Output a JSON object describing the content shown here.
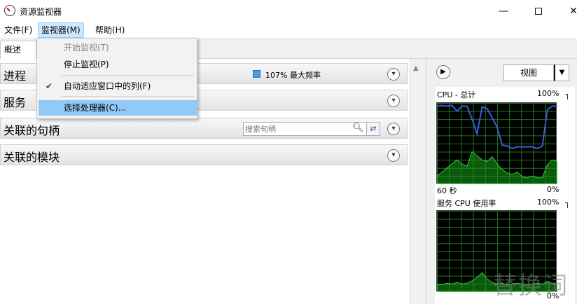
{
  "window": {
    "title": "资源监视器",
    "min": "—",
    "close": "✕"
  },
  "menubar": {
    "items": [
      "文件(F)",
      "监视器(M)",
      "帮助(H)"
    ]
  },
  "tabs": {
    "overview": "概述"
  },
  "left": {
    "sections": [
      {
        "title": "进程"
      },
      {
        "title": "服务"
      },
      {
        "title": "关联的句柄"
      },
      {
        "title": "关联的模块"
      }
    ],
    "process_legend": "107% 最大频率",
    "handles_search_placeholder": "搜索句柄",
    "chevron": "▾"
  },
  "right": {
    "view_button": "视图",
    "cpu_total_label": "CPU - 总计",
    "cpu_total_max": "100%",
    "cpu_time_label": "60 秒",
    "cpu_total_min": "0%",
    "service_cpu_label": "服务 CPU 使用率",
    "service_cpu_max": "100%",
    "service_cpu_min": "0%"
  },
  "dropdown": {
    "items": [
      "开始监视(T)",
      "停止监视(P)",
      "自动适应窗口中的列(F)",
      "选择处理器(C)..."
    ],
    "checked_index": 2,
    "disabled_index": 0,
    "highlight_index": 3
  },
  "watermark": "替换词",
  "colors": {
    "cpu_line": "#3f5bd6",
    "cpu_fill": "#17a117",
    "accent": "#91c9f7"
  },
  "chart_data": [
    {
      "type": "area",
      "title": "CPU - 总计",
      "ylim": [
        0,
        100
      ],
      "series": [
        {
          "values": [
            96,
            97,
            96,
            97,
            90,
            96,
            96,
            80,
            62,
            95,
            93,
            82,
            70,
            48,
            47,
            44,
            46,
            46,
            46,
            46,
            44,
            47,
            92,
            96,
            96
          ]
        },
        {
          "values": [
            10,
            15,
            20,
            25,
            30,
            25,
            22,
            40,
            35,
            30,
            28,
            34,
            25,
            18,
            14,
            12,
            15,
            9,
            8,
            10,
            8,
            8,
            24,
            30,
            28
          ]
        }
      ]
    },
    {
      "type": "area",
      "title": "服务 CPU 使用率",
      "ylim": [
        0,
        100
      ],
      "series": [
        {
          "values": [
            10,
            9,
            11,
            10,
            12,
            10,
            11,
            14,
            18,
            24,
            16,
            12,
            10,
            11,
            9,
            10,
            11,
            10,
            9,
            10,
            11,
            10,
            12,
            11,
            10
          ]
        }
      ]
    }
  ]
}
